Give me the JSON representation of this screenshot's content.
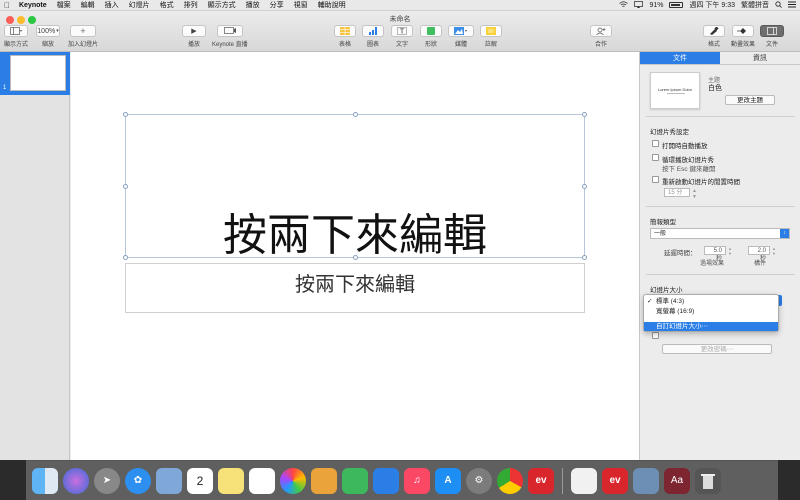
{
  "menubar": {
    "app": "Keynote",
    "items": [
      "檔案",
      "編輯",
      "插入",
      "幻燈片",
      "格式",
      "排列",
      "顯示方式",
      "播放",
      "分享",
      "視窗",
      "輔助說明"
    ],
    "battery": "91%",
    "clock": "週四 下午 9:33",
    "input_method": "繁體拼音"
  },
  "window": {
    "title": "未命名"
  },
  "toolbar": {
    "view": "顯示方式",
    "zoom_value": "100%",
    "zoom": "縮放",
    "add_slide": "加入幻燈片",
    "play": "播放",
    "keynote_live": "Keynote 直播",
    "table": "表格",
    "chart": "圖表",
    "text": "文字",
    "shape": "形狀",
    "media": "媒體",
    "comment": "註解",
    "collaborate": "合作",
    "format": "格式",
    "animate": "動畫效果",
    "document": "文件"
  },
  "navigator": {
    "slide_number": "1"
  },
  "slide": {
    "title": "按兩下來編輯",
    "subtitle": "按兩下來編輯"
  },
  "inspector": {
    "tabs": [
      "文件",
      "資訊"
    ],
    "theme_label": "主題",
    "theme_value": "白色",
    "theme_thumb_text": "Lorem Ipsum Dolor",
    "change_theme": "更改主題",
    "slideshow_settings": "幻燈片秀設定",
    "autoplay": "打開時自動播放",
    "loop": "循環播放幻燈片秀",
    "loop_hint": "按下 Esc 鍵來離開",
    "restart": "重新啟動幻燈片的閒置時間",
    "restart_value": "15 分",
    "presentation_type": "簡報類型",
    "presentation_value": "一般",
    "delay_label": "延遲時間：",
    "transition_delay": "5.0 秒",
    "build_delay": "2.0 秒",
    "transition_label": "過場效果",
    "build_label": "構件",
    "slide_size": "幻燈片大小",
    "size_options": [
      "標準 (4:3)",
      "寬螢幕 (16:9)",
      "自訂幻燈片大小⋯"
    ],
    "change_password": "更改密碼⋯"
  },
  "dock": {
    "calendar_day": "2"
  }
}
